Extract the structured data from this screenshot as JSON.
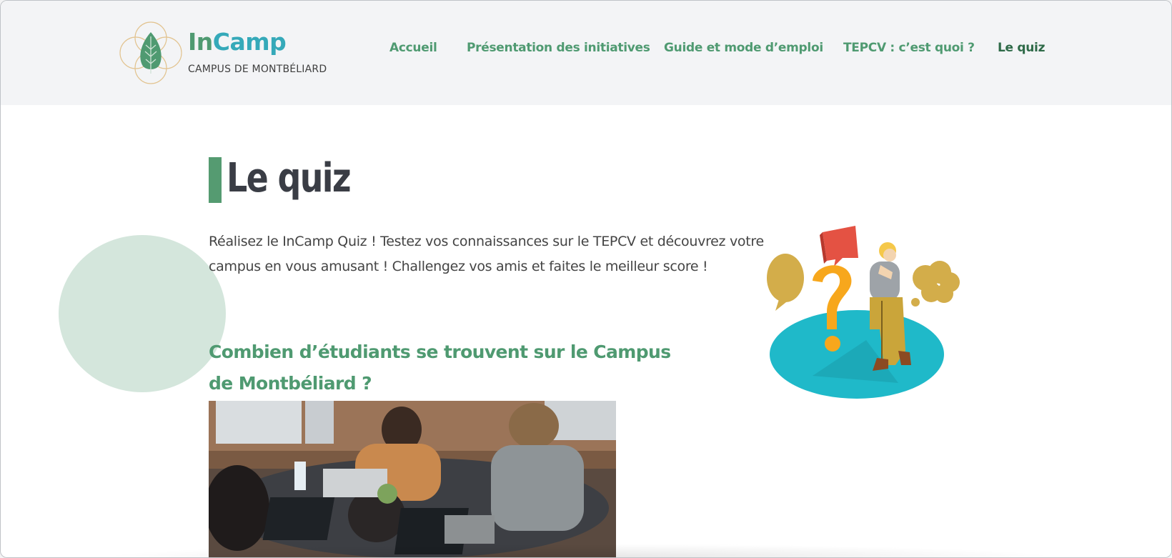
{
  "brand": {
    "title_in": "In",
    "title_camp": "Camp",
    "subtitle": "CAMPUS DE MONTBÉLIARD",
    "colors": {
      "green": "#4f9a71",
      "teal": "#35a9b9",
      "gold": "#e2c38f"
    }
  },
  "nav": {
    "items": [
      {
        "label": "Accueil"
      },
      {
        "label": "Présentation des initiatives"
      },
      {
        "label": "Guide et mode d’emploi"
      },
      {
        "label": "TEPCV : c’est quoi ?"
      },
      {
        "label": "Le quiz",
        "active": true
      }
    ]
  },
  "main": {
    "title": "Le quiz",
    "intro": "Réalisez le InCamp Quiz ! Testez vos connaissances sur le TEPCV et découvrez votre campus en vous amusant ! Challengez vos amis et faites le meilleur score !",
    "question": "Combien d’étudiants se trouvent sur le Campus de Montbéliard ?"
  },
  "icons": {
    "logo": "leaf-flower-logo-icon",
    "illustration": "thinking-person-question-illustration",
    "photo": "students-working-laptops-photo"
  }
}
